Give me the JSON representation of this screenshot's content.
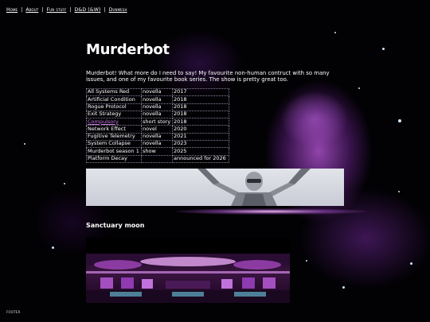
{
  "nav": {
    "items": [
      "Home",
      "About",
      "Fun stuff",
      "D&D (&W)",
      "Dunmesh"
    ]
  },
  "main": {
    "title": "Murderbot",
    "intro": "Murderbot! What more do I need to say! My favourite non-human contruct with so many issues, and one of my favourite book series. The show is pretty great too.",
    "works": [
      {
        "title": "All Systems Red",
        "type": "novella",
        "year": "2017",
        "link": false
      },
      {
        "title": "Artificial Condition",
        "type": "novella",
        "year": "2018",
        "link": false
      },
      {
        "title": "Rogue Protocol",
        "type": "novella",
        "year": "2018",
        "link": false
      },
      {
        "title": "Exit Strategy",
        "type": "novella",
        "year": "2018",
        "link": false
      },
      {
        "title": "Compulsory",
        "type": "short story",
        "year": "2018",
        "link": true
      },
      {
        "title": "Network Effect",
        "type": "novel",
        "year": "2020",
        "link": false
      },
      {
        "title": "Fugitive Telemetry",
        "type": "novella",
        "year": "2021",
        "link": false
      },
      {
        "title": "System Collapse",
        "type": "novella",
        "year": "2023",
        "link": false
      },
      {
        "title": "Murderbot season 1",
        "type": "show",
        "year": "2025",
        "link": false
      },
      {
        "title": "Platform Decay",
        "type": "",
        "year": "announced for 2026",
        "link": false
      }
    ],
    "section2_title": "Sanctuary moon"
  },
  "footer": {
    "text": "footer"
  },
  "colors": {
    "link_accent": "#c77be0",
    "background": "#020104",
    "text": "#ffffff"
  },
  "icons": [
    "robot-banner-image",
    "station-interior-image"
  ]
}
